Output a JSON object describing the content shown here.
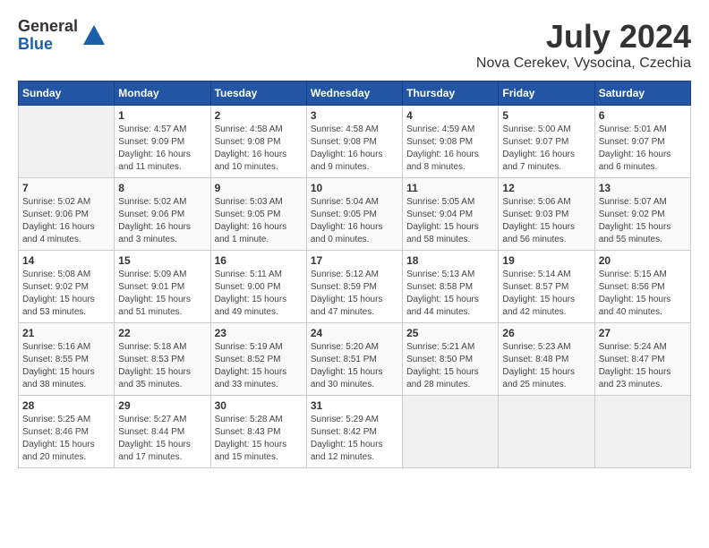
{
  "logo": {
    "general": "General",
    "blue": "Blue"
  },
  "title": "July 2024",
  "subtitle": "Nova Cerekev, Vysocina, Czechia",
  "headers": [
    "Sunday",
    "Monday",
    "Tuesday",
    "Wednesday",
    "Thursday",
    "Friday",
    "Saturday"
  ],
  "weeks": [
    [
      {
        "day": "",
        "info": ""
      },
      {
        "day": "1",
        "info": "Sunrise: 4:57 AM\nSunset: 9:09 PM\nDaylight: 16 hours\nand 11 minutes."
      },
      {
        "day": "2",
        "info": "Sunrise: 4:58 AM\nSunset: 9:08 PM\nDaylight: 16 hours\nand 10 minutes."
      },
      {
        "day": "3",
        "info": "Sunrise: 4:58 AM\nSunset: 9:08 PM\nDaylight: 16 hours\nand 9 minutes."
      },
      {
        "day": "4",
        "info": "Sunrise: 4:59 AM\nSunset: 9:08 PM\nDaylight: 16 hours\nand 8 minutes."
      },
      {
        "day": "5",
        "info": "Sunrise: 5:00 AM\nSunset: 9:07 PM\nDaylight: 16 hours\nand 7 minutes."
      },
      {
        "day": "6",
        "info": "Sunrise: 5:01 AM\nSunset: 9:07 PM\nDaylight: 16 hours\nand 6 minutes."
      }
    ],
    [
      {
        "day": "7",
        "info": "Sunrise: 5:02 AM\nSunset: 9:06 PM\nDaylight: 16 hours\nand 4 minutes."
      },
      {
        "day": "8",
        "info": "Sunrise: 5:02 AM\nSunset: 9:06 PM\nDaylight: 16 hours\nand 3 minutes."
      },
      {
        "day": "9",
        "info": "Sunrise: 5:03 AM\nSunset: 9:05 PM\nDaylight: 16 hours\nand 1 minute."
      },
      {
        "day": "10",
        "info": "Sunrise: 5:04 AM\nSunset: 9:05 PM\nDaylight: 16 hours\nand 0 minutes."
      },
      {
        "day": "11",
        "info": "Sunrise: 5:05 AM\nSunset: 9:04 PM\nDaylight: 15 hours\nand 58 minutes."
      },
      {
        "day": "12",
        "info": "Sunrise: 5:06 AM\nSunset: 9:03 PM\nDaylight: 15 hours\nand 56 minutes."
      },
      {
        "day": "13",
        "info": "Sunrise: 5:07 AM\nSunset: 9:02 PM\nDaylight: 15 hours\nand 55 minutes."
      }
    ],
    [
      {
        "day": "14",
        "info": "Sunrise: 5:08 AM\nSunset: 9:02 PM\nDaylight: 15 hours\nand 53 minutes."
      },
      {
        "day": "15",
        "info": "Sunrise: 5:09 AM\nSunset: 9:01 PM\nDaylight: 15 hours\nand 51 minutes."
      },
      {
        "day": "16",
        "info": "Sunrise: 5:11 AM\nSunset: 9:00 PM\nDaylight: 15 hours\nand 49 minutes."
      },
      {
        "day": "17",
        "info": "Sunrise: 5:12 AM\nSunset: 8:59 PM\nDaylight: 15 hours\nand 47 minutes."
      },
      {
        "day": "18",
        "info": "Sunrise: 5:13 AM\nSunset: 8:58 PM\nDaylight: 15 hours\nand 44 minutes."
      },
      {
        "day": "19",
        "info": "Sunrise: 5:14 AM\nSunset: 8:57 PM\nDaylight: 15 hours\nand 42 minutes."
      },
      {
        "day": "20",
        "info": "Sunrise: 5:15 AM\nSunset: 8:56 PM\nDaylight: 15 hours\nand 40 minutes."
      }
    ],
    [
      {
        "day": "21",
        "info": "Sunrise: 5:16 AM\nSunset: 8:55 PM\nDaylight: 15 hours\nand 38 minutes."
      },
      {
        "day": "22",
        "info": "Sunrise: 5:18 AM\nSunset: 8:53 PM\nDaylight: 15 hours\nand 35 minutes."
      },
      {
        "day": "23",
        "info": "Sunrise: 5:19 AM\nSunset: 8:52 PM\nDaylight: 15 hours\nand 33 minutes."
      },
      {
        "day": "24",
        "info": "Sunrise: 5:20 AM\nSunset: 8:51 PM\nDaylight: 15 hours\nand 30 minutes."
      },
      {
        "day": "25",
        "info": "Sunrise: 5:21 AM\nSunset: 8:50 PM\nDaylight: 15 hours\nand 28 minutes."
      },
      {
        "day": "26",
        "info": "Sunrise: 5:23 AM\nSunset: 8:48 PM\nDaylight: 15 hours\nand 25 minutes."
      },
      {
        "day": "27",
        "info": "Sunrise: 5:24 AM\nSunset: 8:47 PM\nDaylight: 15 hours\nand 23 minutes."
      }
    ],
    [
      {
        "day": "28",
        "info": "Sunrise: 5:25 AM\nSunset: 8:46 PM\nDaylight: 15 hours\nand 20 minutes."
      },
      {
        "day": "29",
        "info": "Sunrise: 5:27 AM\nSunset: 8:44 PM\nDaylight: 15 hours\nand 17 minutes."
      },
      {
        "day": "30",
        "info": "Sunrise: 5:28 AM\nSunset: 8:43 PM\nDaylight: 15 hours\nand 15 minutes."
      },
      {
        "day": "31",
        "info": "Sunrise: 5:29 AM\nSunset: 8:42 PM\nDaylight: 15 hours\nand 12 minutes."
      },
      {
        "day": "",
        "info": ""
      },
      {
        "day": "",
        "info": ""
      },
      {
        "day": "",
        "info": ""
      }
    ]
  ]
}
